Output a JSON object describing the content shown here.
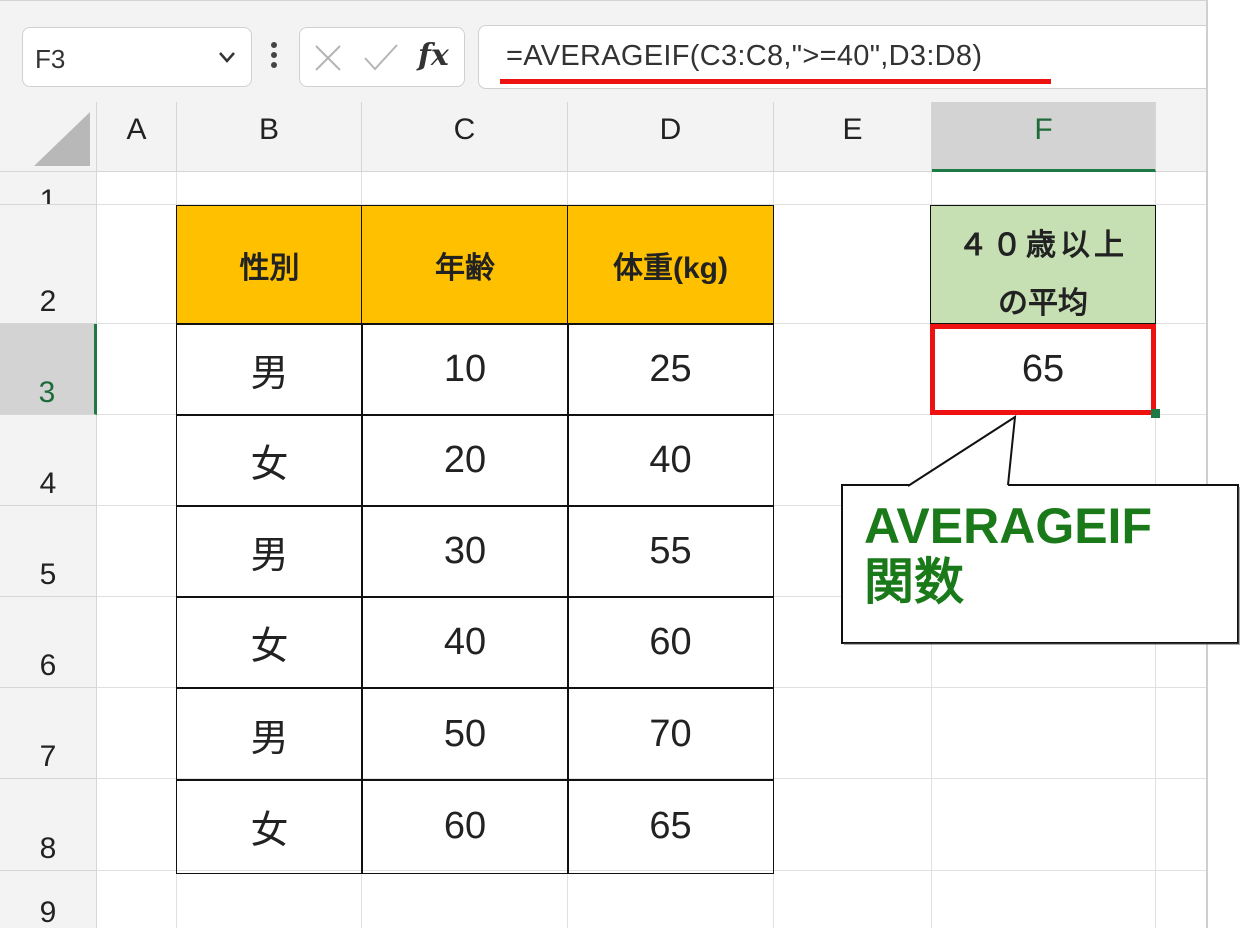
{
  "formula_bar": {
    "name_box": "F3",
    "fx_label": "fx",
    "formula": "=AVERAGEIF(C3:C8,\">=40\",D3:D8)"
  },
  "columns": [
    "A",
    "B",
    "C",
    "D",
    "E",
    "F"
  ],
  "rows": [
    "1",
    "2",
    "3",
    "4",
    "5",
    "6",
    "7",
    "8",
    "9"
  ],
  "table": {
    "headers": [
      "性別",
      "年齢",
      "体重(kg)"
    ],
    "rows": [
      [
        "男",
        "10",
        "25"
      ],
      [
        "女",
        "20",
        "40"
      ],
      [
        "男",
        "30",
        "55"
      ],
      [
        "女",
        "40",
        "60"
      ],
      [
        "男",
        "50",
        "70"
      ],
      [
        "女",
        "60",
        "65"
      ]
    ]
  },
  "result": {
    "header_line1": "４０歳以上",
    "header_line2": "の平均",
    "value": "65"
  },
  "callout": {
    "line1": "AVERAGEIF",
    "line2": "関数"
  },
  "colors": {
    "table_header": "#ffc000",
    "result_header": "#c6e0b4",
    "highlight_red": "#ee1111",
    "callout_text": "#1a7a1a",
    "excel_green": "#1e7a44"
  }
}
